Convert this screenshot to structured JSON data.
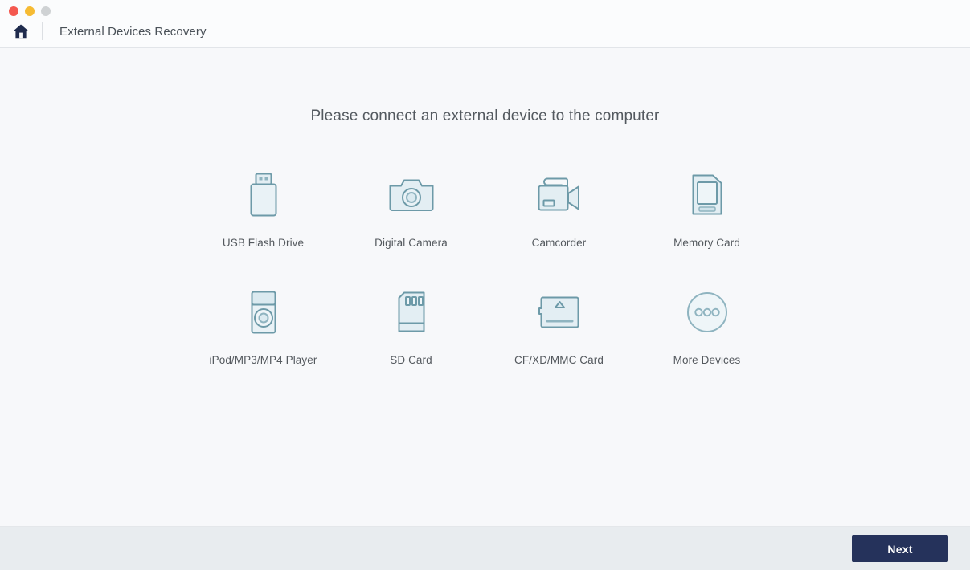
{
  "window": {
    "title": "External Devices Recovery",
    "home_icon": "home-icon",
    "traffic_lights": [
      {
        "name": "close",
        "color": "#f4584f"
      },
      {
        "name": "minimize",
        "color": "#f6bb33"
      },
      {
        "name": "zoom",
        "color": "#cfd2d4"
      }
    ]
  },
  "main": {
    "headline": "Please connect an external device to the computer",
    "devices": [
      {
        "label": "USB Flash Drive",
        "icon": "usb-flash-drive-icon"
      },
      {
        "label": "Digital Camera",
        "icon": "digital-camera-icon"
      },
      {
        "label": "Camcorder",
        "icon": "camcorder-icon"
      },
      {
        "label": "Memory Card",
        "icon": "memory-card-icon"
      },
      {
        "label": "iPod/MP3/MP4 Player",
        "icon": "ipod-player-icon"
      },
      {
        "label": "SD Card",
        "icon": "sd-card-icon"
      },
      {
        "label": "CF/XD/MMC Card",
        "icon": "cf-xd-mmc-card-icon"
      },
      {
        "label": "More Devices",
        "icon": "more-devices-icon"
      }
    ]
  },
  "footer": {
    "next_label": "Next"
  },
  "colors": {
    "background": "#f7f8fa",
    "titlebar": "#fbfcfd",
    "footer": "#e8ecef",
    "icon_stroke": "#6d9aa8",
    "icon_fill": "#e3eef3",
    "accent_button": "#25325b",
    "text": "#54595e",
    "home_icon": "#1f2b4d"
  }
}
